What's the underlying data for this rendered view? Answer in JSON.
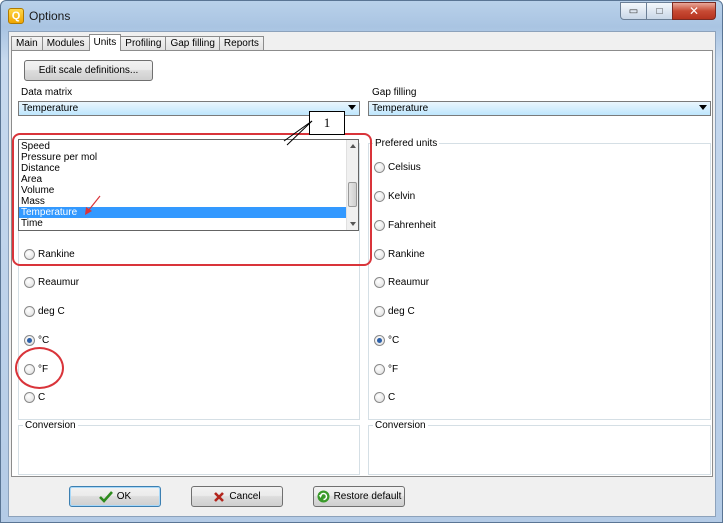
{
  "window": {
    "title": "Options",
    "app_icon": "Q"
  },
  "window_buttons": {
    "minimize": "▭",
    "maximize": "□",
    "close": "✕"
  },
  "tabs": [
    {
      "label": "Main"
    },
    {
      "label": "Modules"
    },
    {
      "label": "Units",
      "active": true
    },
    {
      "label": "Profiling"
    },
    {
      "label": "Gap filling"
    },
    {
      "label": "Reports"
    }
  ],
  "edit_scale_button": "Edit scale definitions...",
  "data_matrix": {
    "label": "Data matrix",
    "selected": "Temperature",
    "dropdown_items": [
      "Speed",
      "Pressure per mol",
      "Distance",
      "Area",
      "Volume",
      "Mass",
      "Temperature",
      "Time"
    ],
    "dropdown_selected_index": 6,
    "units": [
      {
        "label": "Rankine",
        "checked": false
      },
      {
        "label": "Reaumur",
        "checked": false
      },
      {
        "label": "deg C",
        "checked": false
      },
      {
        "label": "°C",
        "checked": true
      },
      {
        "label": "°F",
        "checked": false
      },
      {
        "label": "C",
        "checked": false
      }
    ],
    "conversion_label": "Conversion"
  },
  "gap_filling": {
    "label": "Gap filling",
    "selected": "Temperature",
    "prefered_units_label": "Prefered units",
    "units": [
      {
        "label": "Celsius",
        "checked": false
      },
      {
        "label": "Kelvin",
        "checked": false
      },
      {
        "label": "Fahrenheit",
        "checked": false
      },
      {
        "label": "Rankine",
        "checked": false
      },
      {
        "label": "Reaumur",
        "checked": false
      },
      {
        "label": "deg C",
        "checked": false
      },
      {
        "label": "°C",
        "checked": true
      },
      {
        "label": "°F",
        "checked": false
      },
      {
        "label": "C",
        "checked": false
      }
    ],
    "conversion_label": "Conversion"
  },
  "annotation": {
    "callout_number": "1"
  },
  "footer": {
    "ok": "OK",
    "cancel": "Cancel",
    "restore": "Restore default"
  },
  "colors": {
    "annotation_red": "#d9343a",
    "selection_blue": "#3399ff"
  }
}
